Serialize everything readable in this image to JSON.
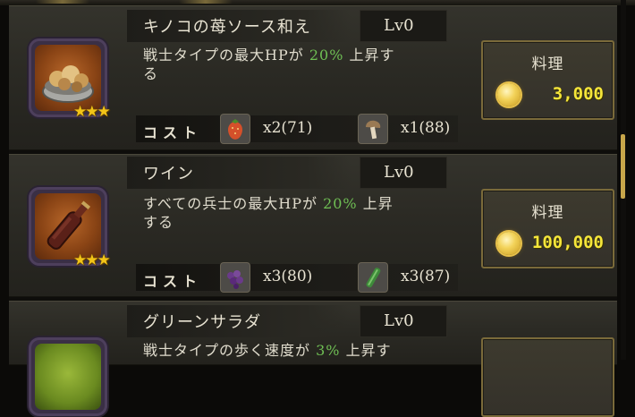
{
  "recipes": [
    {
      "name": "キノコの苺ソース和え",
      "level": "Lv0",
      "desc_prefix": "戦士タイプの最大HPが",
      "desc_pct": "20%",
      "desc_suffix": "上昇す",
      "desc_line2": "る",
      "cost_label": "コスト",
      "ingredients": [
        {
          "icon": "strawberry-icon",
          "qty": "x2(71)"
        },
        {
          "icon": "mushroom-icon",
          "qty": "x1(88)"
        }
      ],
      "stars": "★★★",
      "cook_label": "料理",
      "price": "3,000"
    },
    {
      "name": "ワイン",
      "level": "Lv0",
      "desc_prefix": "すべての兵士の最大HPが",
      "desc_pct": "20%",
      "desc_suffix": "上昇",
      "desc_line2": "する",
      "cost_label": "コスト",
      "ingredients": [
        {
          "icon": "grape-icon",
          "qty": "x3(80)"
        },
        {
          "icon": "cucumber-icon",
          "qty": "x3(87)"
        }
      ],
      "stars": "★★★",
      "cook_label": "料理",
      "price": "100,000"
    },
    {
      "name": "グリーンサラダ",
      "level": "Lv0",
      "desc_prefix": "戦士タイプの歩く速度が",
      "desc_pct": "3%",
      "desc_suffix": "上昇す",
      "desc_line2": "",
      "cost_label": "",
      "ingredients": [],
      "stars": "",
      "cook_label": "",
      "price": ""
    }
  ],
  "colors": {
    "accent_green": "#6fbf54",
    "price_yellow": "#f5e63a",
    "star": "#f2c418"
  }
}
